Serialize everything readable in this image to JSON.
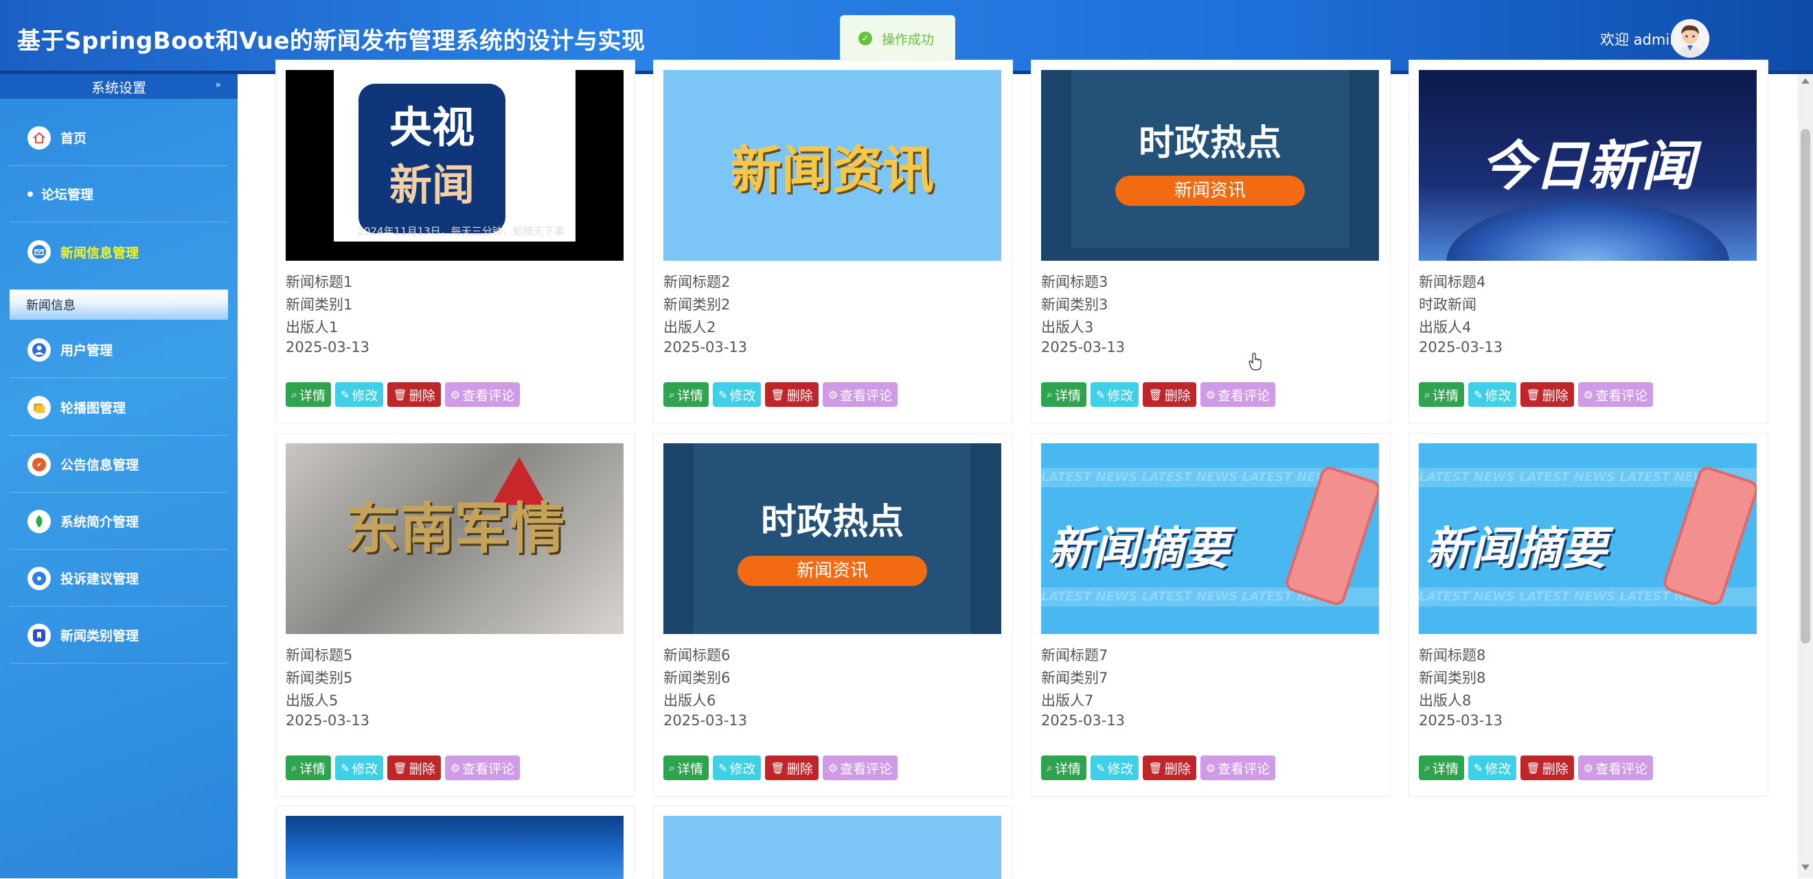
{
  "header": {
    "title": "基于SpringBoot和Vue的新闻发布管理系统的设计与实现",
    "welcome": "欢迎 admin"
  },
  "toast": {
    "message": "操作成功"
  },
  "sidebar": {
    "section_title": "系统设置",
    "items": [
      {
        "label": "首页",
        "icon": "home-icon",
        "color": "#e44d3a"
      },
      {
        "label": "论坛管理",
        "icon": "dot-icon"
      },
      {
        "label": "新闻信息管理",
        "icon": "mail-icon",
        "color": "#2d7fe0",
        "active": true
      },
      {
        "label": "用户管理",
        "icon": "user-icon",
        "color": "#2d6cd9"
      },
      {
        "label": "轮播图管理",
        "icon": "images-icon",
        "color": "#f0a020"
      },
      {
        "label": "公告信息管理",
        "icon": "compass-icon",
        "color": "#e06030"
      },
      {
        "label": "系统简介管理",
        "icon": "leaf-icon",
        "color": "#20b040"
      },
      {
        "label": "投诉建议管理",
        "icon": "target-icon",
        "color": "#2f7fe0"
      },
      {
        "label": "新闻类别管理",
        "icon": "bookmark-icon",
        "color": "#2d4fc9"
      }
    ],
    "sub_item": "新闻信息"
  },
  "buttons": {
    "detail": "详情",
    "edit": "修改",
    "delete": "删除",
    "comments": "查看评论"
  },
  "cards": [
    {
      "title": "新闻标题1",
      "category": "新闻类别1",
      "publisher": "出版人1",
      "date": "2025-03-13",
      "thumb_line1": "央视",
      "thumb_line2": "新闻",
      "thumb_caption": "2024年11月13日，每天三分钟，知晓天下事"
    },
    {
      "title": "新闻标题2",
      "category": "新闻类别2",
      "publisher": "出版人2",
      "date": "2025-03-13",
      "thumb_text": "新闻资讯"
    },
    {
      "title": "新闻标题3",
      "category": "新闻类别3",
      "publisher": "出版人3",
      "date": "2025-03-13",
      "thumb_text": "时政热点",
      "thumb_pill": "新闻资讯"
    },
    {
      "title": "新闻标题4",
      "category": "时政新闻",
      "publisher": "出版人4",
      "date": "2025-03-13",
      "thumb_text": "今日新闻"
    },
    {
      "title": "新闻标题5",
      "category": "新闻类别5",
      "publisher": "出版人5",
      "date": "2025-03-13",
      "thumb_text": "东南军情"
    },
    {
      "title": "新闻标题6",
      "category": "新闻类别6",
      "publisher": "出版人6",
      "date": "2025-03-13",
      "thumb_text": "时政热点",
      "thumb_pill": "新闻资讯"
    },
    {
      "title": "新闻标题7",
      "category": "新闻类别7",
      "publisher": "出版人7",
      "date": "2025-03-13",
      "thumb_text": "新闻摘要",
      "thumb_band": "LATEST NEWS  LATEST NEWS  LATEST NEWS"
    },
    {
      "title": "新闻标题8",
      "category": "新闻类别8",
      "publisher": "出版人8",
      "date": "2025-03-13",
      "thumb_text": "新闻摘要",
      "thumb_band": "LATEST NEWS  LATEST NEWS  LATEST NEWS"
    }
  ]
}
